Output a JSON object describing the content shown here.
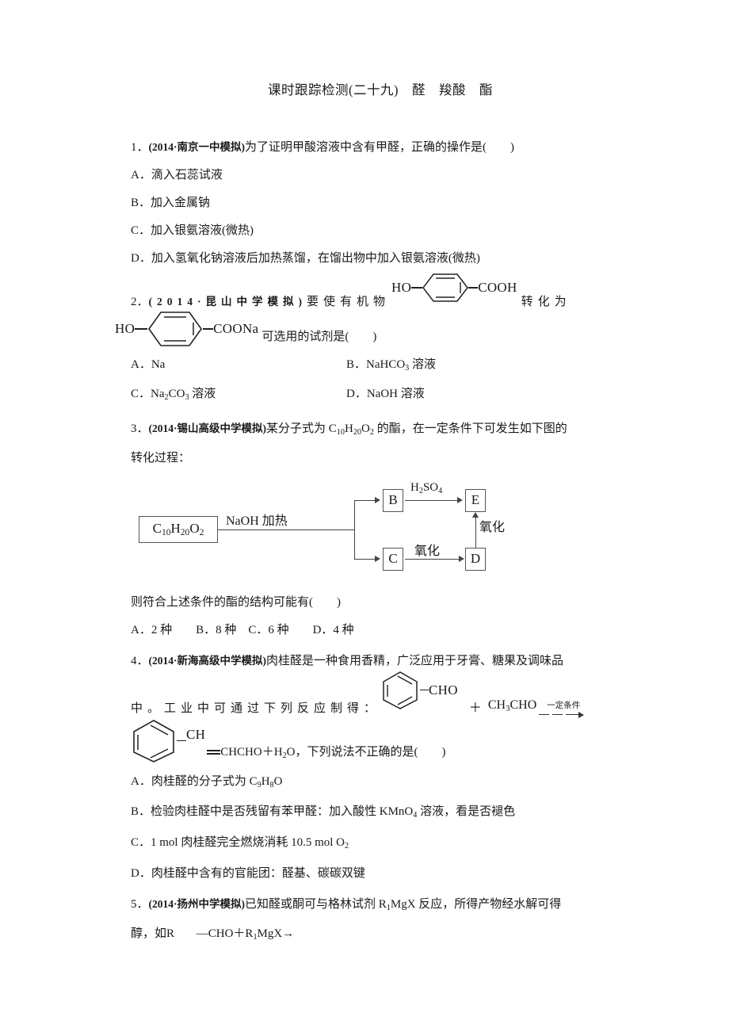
{
  "document": {
    "title": "课时跟踪检测(二十九)　醛　羧酸　酯"
  },
  "questions": [
    {
      "number": "1",
      "source": "(2014·南京一中模拟)",
      "prefix": "1．",
      "stem": "为了证明甲酸溶液中含有甲醛，正确的操作是(　　)",
      "options": [
        "A．滴入石蕊试液",
        "B．加入金属钠",
        "C．加入银氨溶液(微热)",
        "D．加入氢氧化钠溶液后加热蒸馏，在馏出物中加入银氨溶液(微热)"
      ]
    },
    {
      "number": "2",
      "prefix": "2．",
      "source": "(2014·昆山中学模拟)",
      "stem_part1": "要使有机物",
      "stem_part2": "转化为",
      "stem_part3": "可选用的试剂是(　　)",
      "struct1": {
        "left_label": "HO",
        "right_label": "COOH"
      },
      "struct2": {
        "left_label": "HO",
        "right_label": "COONa"
      },
      "options": [
        "A．Na",
        "B．NaHCO3 溶液",
        "C．Na2CO3 溶液",
        "D．NaOH 溶液"
      ],
      "options_rich": [
        {
          "label": "A．",
          "formula": "Na",
          "suffix": ""
        },
        {
          "label": "B．",
          "formula": "NaHCO",
          "sub": "3",
          "suffix": "溶液"
        },
        {
          "label": "C．",
          "formula": "Na2CO3",
          "suffix": "溶液"
        },
        {
          "label": "D．",
          "formula": "NaOH",
          "suffix": "溶液"
        }
      ]
    },
    {
      "number": "3",
      "prefix": "3．",
      "source": "(2014·锡山高级中学模拟)",
      "stem": "某分子式为 C10H20O2 的酯，在一定条件下可发生如下图的转化过程：",
      "stem_line1_a": "某分子式为 C",
      "stem_line1_b": "的酯，在一定条件下可发生如下图的",
      "stem_line2": "转化过程：",
      "after_scheme": "则符合上述条件的酯的结构可能有(　　)",
      "options_inline": "A．2 种　　B．8 种　C．6 种　　D．4 种",
      "scheme": {
        "start_box": "C10H20O2",
        "start_formula": {
          "c": "C",
          "c_sub": "10",
          "h": "H",
          "h_sub": "20",
          "o": "O",
          "o_sub": "2"
        },
        "main_label": "NaOH 加热",
        "box_b": "B",
        "box_c": "C",
        "box_d": "D",
        "box_e": "E",
        "label_h2so4": "H2SO4",
        "label_oxidize_top": "氧化",
        "label_oxidize_bottom": "氧化"
      }
    },
    {
      "number": "4",
      "prefix": "4．",
      "source": "(2014·新海高级中学模拟)",
      "stem_line1": "肉桂醛是一种食用香精，广泛应用于牙膏、糖果及调味品",
      "stem_line2": "中。工业中可通过下列反应制得：",
      "reagent": "CH3CHO",
      "plus": "＋",
      "condition": "一定条件",
      "ring1_right": "CHO",
      "ring2_right": "CH",
      "product_tail": "CHCHO＋H2O，下列说法不正确的是(　　)",
      "options": [
        "A．肉桂醛的分子式为 C9H8O",
        "B．检验肉桂醛中是否残留有苯甲醛：加入酸性 KMnO4 溶液，看是否褪色",
        "C．1 mol 肉桂醛完全燃烧消耗 10.5 mol O2",
        "D．肉桂醛中含有的官能团：醛基、碳碳双键"
      ]
    },
    {
      "number": "5",
      "prefix": "5．",
      "source": "(2014·扬州中学模拟)",
      "stem_line1": "已知醛或酮可与格林试剂 R1MgX 反应，所得产物经水解可得",
      "stem_line2_a": "醇，如R",
      "stem_line2_b": "—CHO＋R1MgX→"
    }
  ]
}
